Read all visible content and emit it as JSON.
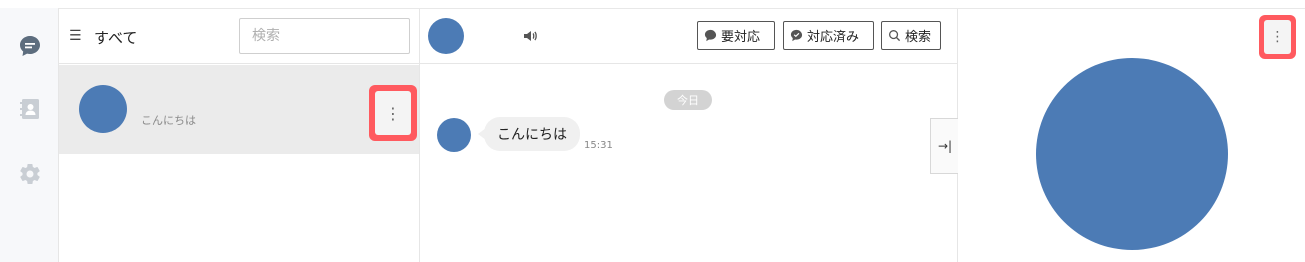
{
  "list": {
    "title": "すべて",
    "search_placeholder": "検索"
  },
  "chat_item": {
    "preview": "こんにちは"
  },
  "conversation": {
    "buttons": {
      "needs_action": "要対応",
      "done": "対応済み",
      "search": "検索"
    },
    "date_label": "今日",
    "message": {
      "text": "こんにちは",
      "time": "15:31"
    }
  },
  "icons": {
    "rail": [
      "chat-icon",
      "contacts-icon",
      "gear-icon"
    ],
    "more": "more-vertical-icon",
    "collapse": "collapse-right-icon",
    "speaker": "speaker-icon"
  },
  "colors": {
    "avatar": "#4c7bb5",
    "highlight": "#ff5a5f",
    "selected_row": "#ebebeb",
    "rail_active": "#5d6d7e",
    "rail_inactive": "#c9ced4"
  }
}
